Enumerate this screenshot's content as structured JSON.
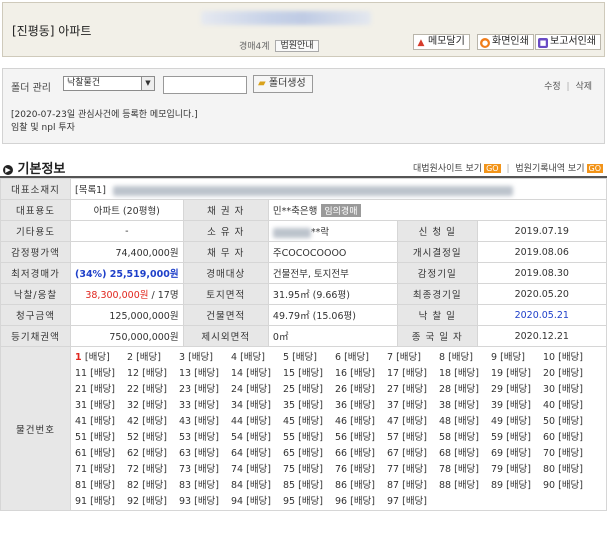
{
  "header": {
    "title": "[진평동] 아파트",
    "court": "경매4계",
    "court_guide_label": "법원안내",
    "buttons": [
      {
        "label": "메모달기",
        "icon": "memo-icon",
        "color": "#d63b2a"
      },
      {
        "label": "화면인쇄",
        "icon": "print-icon",
        "color": "#f07d1a"
      },
      {
        "label": "보고서인쇄",
        "icon": "report-icon",
        "color": "#6a4bc4"
      }
    ]
  },
  "folder": {
    "label": "폴더 관리",
    "select_value": "낙찰물건",
    "create_label": "폴더생성",
    "edit_label": "수정",
    "delete_label": "삭제",
    "sep": "|",
    "memo_line1": "[2020-07-23일 관심사건에 등록한 메모입니다.]",
    "memo_line2": "임찰 및 npl 투자"
  },
  "section": {
    "title": "기본정보",
    "link1": "대법원사이트 보기",
    "link2": "법원기록내역 보기",
    "go": "GO"
  },
  "info": {
    "addr_label": "대표소재지",
    "addr_value": "[목록1]",
    "r1": {
      "l1": "대표용도",
      "v1": "아파트 (20평형)",
      "l2": "채 권 자",
      "v2": "민**축은행",
      "badge": "임의경매"
    },
    "r2": {
      "l1": "기타용도",
      "v1": "-",
      "l2": "소 유 자",
      "v2": "**락",
      "l3": "신 청 일",
      "v3": "2019.07.19"
    },
    "r3": {
      "l1": "감정평가액",
      "v1": "74,400,000원",
      "l2": "채 무 자",
      "v2": "주COCOCOOOO",
      "l3": "개시결정일",
      "v3": "2019.08.06"
    },
    "r4": {
      "l1": "최저경매가",
      "v1": "(34%) 25,519,000원",
      "l2": "경매대상",
      "v2": "건물전부, 토지전부",
      "l3": "감정기일",
      "v3": "2019.08.30"
    },
    "r5": {
      "l1": "낙찰/응찰",
      "v1a": "38,300,000원",
      "v1b": "/ 17명",
      "l2": "토지면적",
      "v2": "31.95㎡ (9.66평)",
      "l3": "최종경기일",
      "v3": "2020.05.20"
    },
    "r6": {
      "l1": "청구금액",
      "v1": "125,000,000원",
      "l2": "건물면적",
      "v2": "49.79㎡ (15.06평)",
      "l3": "낙 찰 일",
      "v3": "2020.05.21"
    },
    "r7": {
      "l1": "등기채권액",
      "v1": "750,000,000원",
      "l2": "제시외면적",
      "v2": "0㎡",
      "l3": "종 국 일 자",
      "v3": "2020.12.21"
    },
    "items_label": "물건번호",
    "items": [
      "1 [배당]",
      "2 [배당]",
      "3 [배당]",
      "4 [배당]",
      "5 [배당]",
      "6 [배당]",
      "7 [배당]",
      "8 [배당]",
      "9 [배당]",
      "10 [배당]",
      "11 [배당]",
      "12 [배당]",
      "13 [배당]",
      "14 [배당]",
      "15 [배당]",
      "16 [배당]",
      "17 [배당]",
      "18 [배당]",
      "19 [배당]",
      "20 [배당]",
      "21 [배당]",
      "22 [배당]",
      "23 [배당]",
      "24 [배당]",
      "25 [배당]",
      "26 [배당]",
      "27 [배당]",
      "28 [배당]",
      "29 [배당]",
      "30 [배당]",
      "31 [배당]",
      "32 [배당]",
      "33 [배당]",
      "34 [배당]",
      "35 [배당]",
      "36 [배당]",
      "37 [배당]",
      "38 [배당]",
      "39 [배당]",
      "40 [배당]",
      "41 [배당]",
      "42 [배당]",
      "43 [배당]",
      "44 [배당]",
      "45 [배당]",
      "46 [배당]",
      "47 [배당]",
      "48 [배당]",
      "49 [배당]",
      "50 [배당]",
      "51 [배당]",
      "52 [배당]",
      "53 [배당]",
      "54 [배당]",
      "55 [배당]",
      "56 [배당]",
      "57 [배당]",
      "58 [배당]",
      "59 [배당]",
      "60 [배당]",
      "61 [배당]",
      "62 [배당]",
      "63 [배당]",
      "64 [배당]",
      "65 [배당]",
      "66 [배당]",
      "67 [배당]",
      "68 [배당]",
      "69 [배당]",
      "70 [배당]",
      "71 [배당]",
      "72 [배당]",
      "73 [배당]",
      "74 [배당]",
      "75 [배당]",
      "76 [배당]",
      "77 [배당]",
      "78 [배당]",
      "79 [배당]",
      "80 [배당]",
      "81 [배당]",
      "82 [배당]",
      "83 [배당]",
      "84 [배당]",
      "85 [배당]",
      "86 [배당]",
      "87 [배당]",
      "88 [배당]",
      "89 [배당]",
      "90 [배당]",
      "91 [배당]",
      "92 [배당]",
      "93 [배당]",
      "94 [배당]",
      "95 [배당]",
      "96 [배당]",
      "97 [배당]"
    ]
  },
  "colors": {
    "price_red": "#e0261e",
    "min_blue": "#1e3fc9",
    "date_blue": "#1e3fc9",
    "go_orange": "#f29419"
  }
}
